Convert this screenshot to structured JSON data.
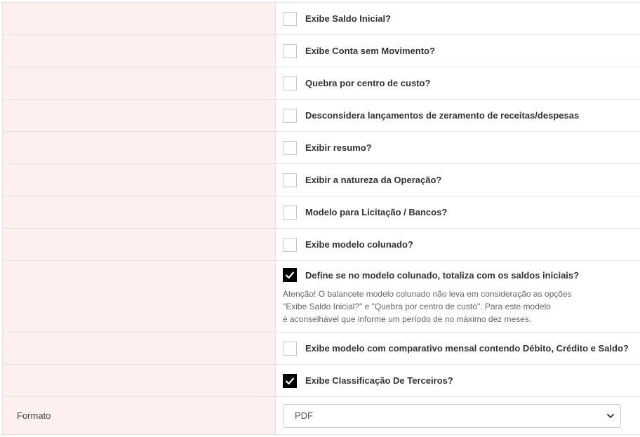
{
  "options": [
    {
      "label": "Exibe Saldo Inicial?",
      "checked": false
    },
    {
      "label": "Exibe Conta sem Movimento?",
      "checked": false
    },
    {
      "label": "Quebra por centro de custo?",
      "checked": false
    },
    {
      "label": "Desconsidera lançamentos de zeramento de receitas/despesas",
      "checked": false
    },
    {
      "label": "Exibir resumo?",
      "checked": false
    },
    {
      "label": "Exibir a natureza da Operação?",
      "checked": false
    },
    {
      "label": "Modelo para Licitação / Bancos?",
      "checked": false
    },
    {
      "label": "Exibe modelo colunado?",
      "checked": false
    },
    {
      "label": "Define se no modelo colunado, totaliza com os saldos iniciais?",
      "checked": true
    },
    {
      "label": "Exibe modelo com comparativo mensal contendo Débito, Crédito e Saldo?",
      "checked": false
    },
    {
      "label": "Exibe Classificação De Terceiros?",
      "checked": true
    }
  ],
  "note_lines": [
    "Atenção! O balancete modelo colunado não leva em consideração as opções",
    "\"Exibe Saldo Inicial?\" e \"Quebra por centro de custo\". Para este modelo",
    "é aconselhável que informe um período de no máximo dez meses."
  ],
  "formato": {
    "label": "Formato",
    "selected": "PDF"
  }
}
